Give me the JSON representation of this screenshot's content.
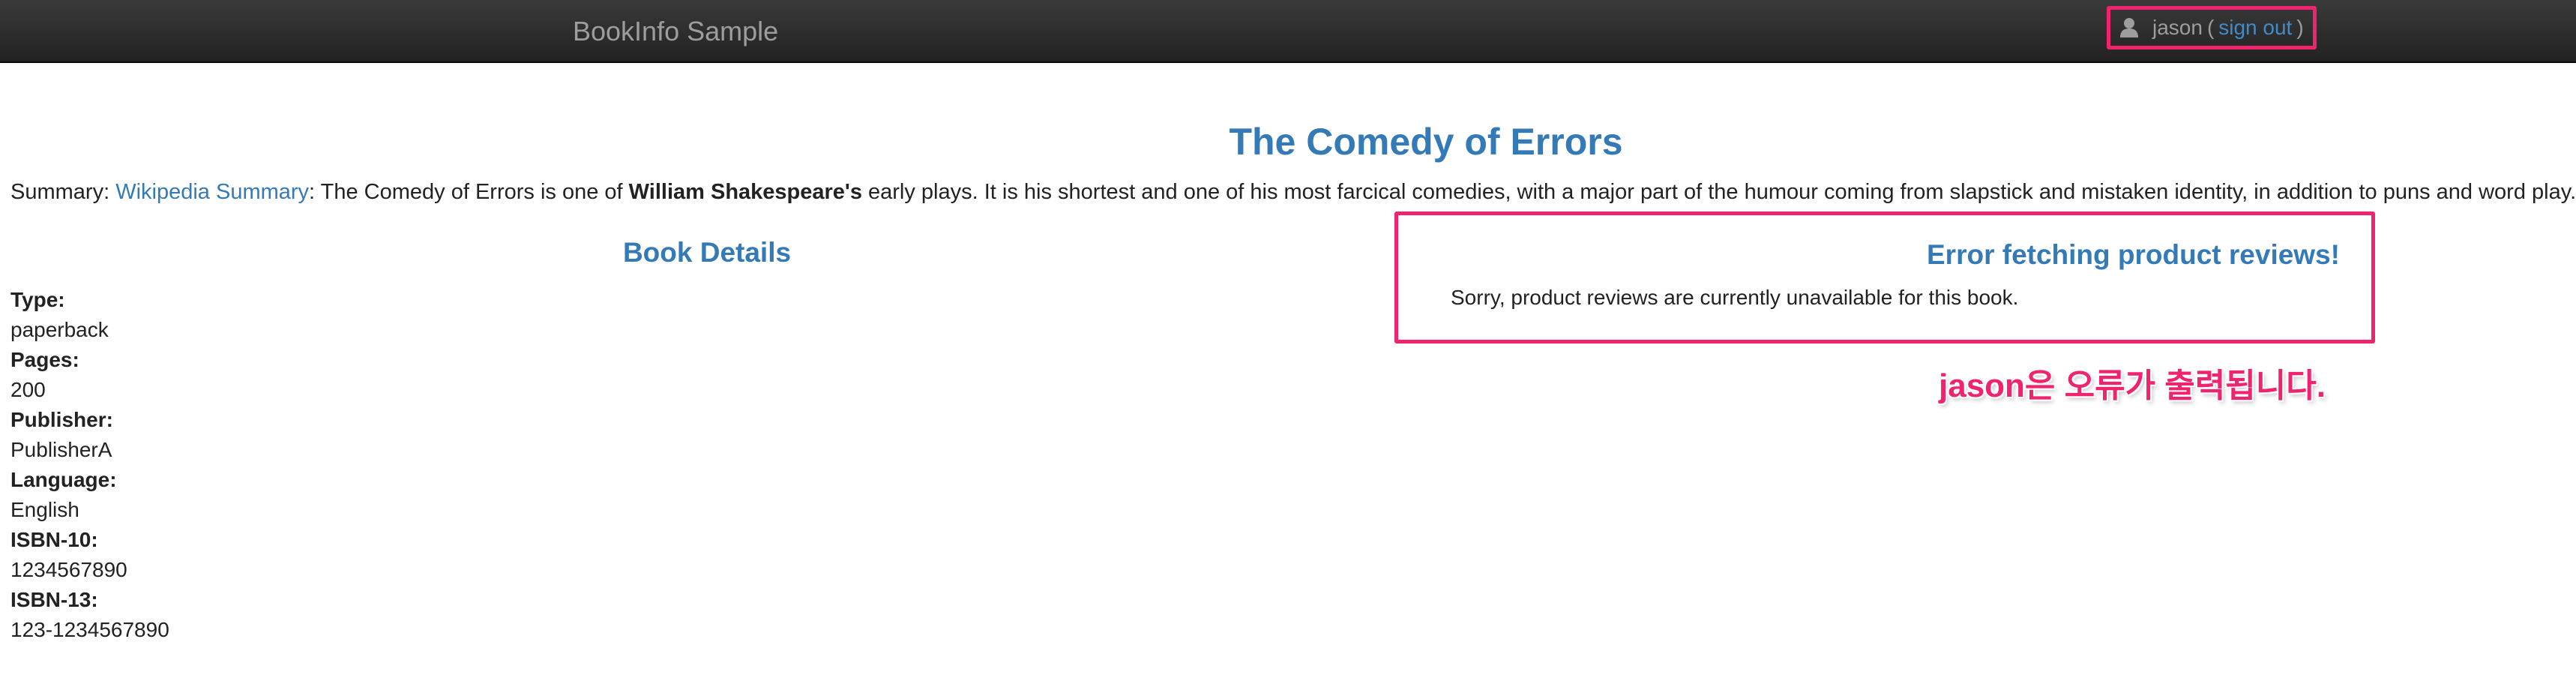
{
  "navbar": {
    "brand": "BookInfo Sample",
    "user": {
      "icon": "user-icon",
      "name": "jason",
      "open_paren": "(",
      "signout_label": "sign out",
      "close_paren": ")"
    }
  },
  "book": {
    "title": "The Comedy of Errors",
    "summary": {
      "label": "Summary:",
      "link_text": "Wikipedia Summary",
      "text_before_bold": ": The Comedy of Errors is one of",
      "bold_text": "William Shakespeare's",
      "text_after_bold": "early plays. It is his shortest and one of his most farcical comedies, with a major part of the humour coming from slapstick and mistaken identity, in addition to puns and word play."
    }
  },
  "details": {
    "heading": "Book Details",
    "items": [
      {
        "label": "Type:",
        "value": "paperback"
      },
      {
        "label": "Pages:",
        "value": "200"
      },
      {
        "label": "Publisher:",
        "value": "PublisherA"
      },
      {
        "label": "Language:",
        "value": "English"
      },
      {
        "label": "ISBN-10:",
        "value": "1234567890"
      },
      {
        "label": "ISBN-13:",
        "value": "123-1234567890"
      }
    ]
  },
  "reviews": {
    "heading": "Error fetching product reviews!",
    "message": "Sorry, product reviews are currently unavailable for this book."
  },
  "annotation": {
    "text": "jason은 오류가 출력됩니다."
  },
  "colors": {
    "link": "#337ab7",
    "highlight": "#f0246e",
    "navbar": "#222222"
  }
}
